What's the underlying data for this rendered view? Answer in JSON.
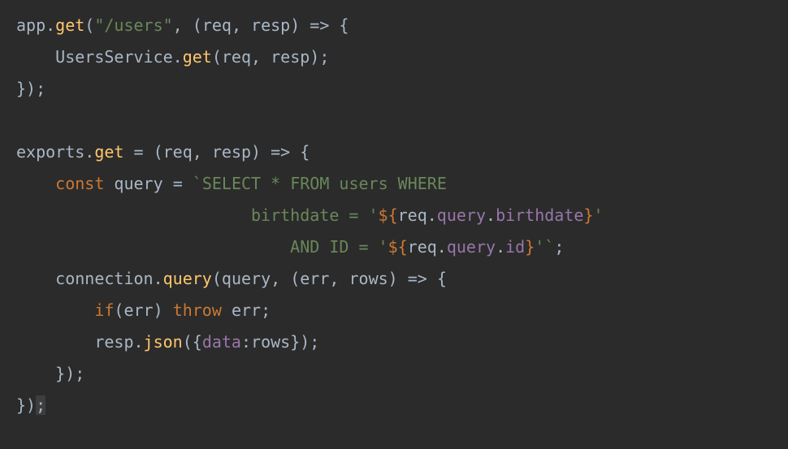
{
  "code": {
    "t_app": "app",
    "t_dot": ".",
    "t_get": "get",
    "t_open": "(",
    "t_close": ")",
    "t_str_users": "\"/users\"",
    "t_comma": ", ",
    "t_req": "req",
    "t_resp": "resp",
    "t_arrow": " => {",
    "t_UsersService": "UsersService",
    "t_semicolon": ";",
    "t_closebrace_paren": "});",
    "t_exports": "exports",
    "t_eq": " = ",
    "t_const": "const",
    "t_query": " query ",
    "t_assign": "= ",
    "t_backtick": "`",
    "t_sql_select": "SELECT * FROM users WHERE",
    "t_sql_birthdate": "birthdate = '",
    "t_interp_open": "${",
    "t_req2": "req",
    "t_query2": "query",
    "t_birthdate": "birthdate",
    "t_interp_close": "}",
    "t_sql_close_quote": "'",
    "t_sql_and": "  AND ID = '",
    "t_id_prop": "id",
    "t_end_semi": ";",
    "t_connection": "connection",
    "t_queryfn": "query",
    "t_query_var": "query",
    "t_err": "err",
    "t_rows": "rows",
    "t_if": "if",
    "t_throw": "throw",
    "t_json": "json",
    "t_data": "data",
    "t_colon": ":",
    "t_open_brace": "{",
    "t_close_brace": "}",
    "indent1": "    ",
    "indent2": "        ",
    "indent6": "                        ",
    "indent7": "                          "
  }
}
